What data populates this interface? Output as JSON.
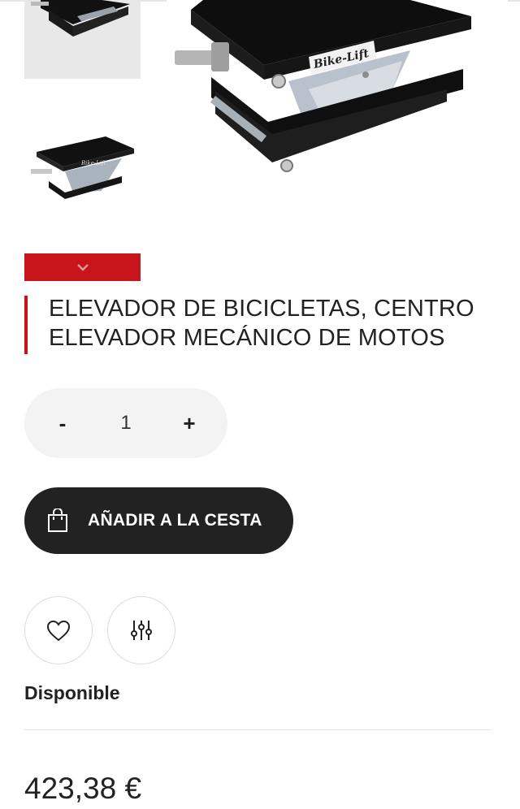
{
  "product": {
    "title": "ELEVADOR DE BICICLETAS, CENTRO ELEVADOR MECÁNICO DE MOTOS",
    "brand_logo_text": "Bike-Lift",
    "quantity": "1",
    "decrease_label": "-",
    "increase_label": "+",
    "add_to_cart_label": "AÑADIR A LA CESTA",
    "availability": "Disponible",
    "price": "423,38 €"
  },
  "icons": {
    "thumb_nav": "chevron-down-icon",
    "cart": "shopping-bag-icon",
    "wishlist": "heart-icon",
    "compare": "sliders-icon"
  },
  "colors": {
    "accent": "#c8141b",
    "button_dark": "#222222",
    "qty_bg": "#f3f3f3"
  }
}
